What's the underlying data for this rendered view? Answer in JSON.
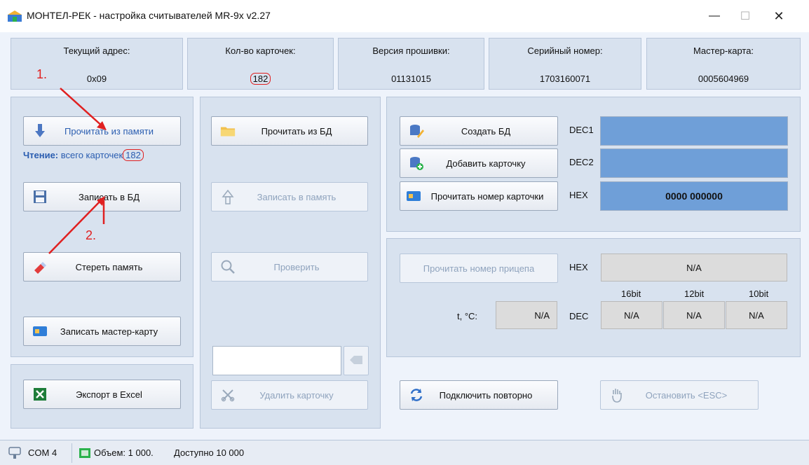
{
  "window": {
    "title": "МОНТЕЛ-РЕК - настройка считывателей MR-9x v2.27",
    "minimize": "—",
    "maximize": "☐",
    "close": "✕"
  },
  "header": [
    {
      "label": "Текущий адрес:",
      "value": "0x09"
    },
    {
      "label": "Кол-во карточек:",
      "value": "182"
    },
    {
      "label": "Версия прошивки:",
      "value": "01131015"
    },
    {
      "label": "Серийный номер:",
      "value": "1703160071"
    },
    {
      "label": "Мастер-карта:",
      "value": "0005604969"
    }
  ],
  "left_panel": {
    "read_memory": "Прочитать из памяти",
    "reading_label": "Чтение:",
    "reading_text": "всего карточек",
    "reading_count": "182",
    "write_db": "Записать в БД",
    "erase_memory": "Стереть память",
    "write_master": "Записать мастер-карту",
    "export_excel": "Экспорт в Excel"
  },
  "middle_panel": {
    "read_db": "Прочитать из БД",
    "write_memory": "Записать в память",
    "check": "Проверить",
    "card_input_value": "",
    "delete_card": "Удалить карточку"
  },
  "right_top": {
    "create_db": "Создать БД",
    "add_card": "Добавить карточку",
    "read_card_number": "Прочитать номер карточки",
    "dec1_label": "DEC1",
    "dec2_label": "DEC2",
    "hex_label": "HEX",
    "dec1_value": "",
    "dec2_value": "",
    "hex_value": "0000 000000"
  },
  "right_bottom": {
    "read_trailer": "Прочитать номер прицепа",
    "hex_label": "HEX",
    "hex_value": "N/A",
    "col_16": "16bit",
    "col_12": "12bit",
    "col_10": "10bit",
    "temp_label": "t, °C:",
    "temp_value": "N/A",
    "dec_label": "DEC",
    "dec_16": "N/A",
    "dec_12": "N/A",
    "dec_10": "N/A"
  },
  "actions": {
    "reconnect": "Подключить повторно",
    "stop": "Остановить <ESC>"
  },
  "annotations": {
    "step1": "1.",
    "step2": "2."
  },
  "status": {
    "port": "COM 4",
    "volume": "Объем: 1 000.",
    "available": "Доступно 10 000"
  },
  "colors": {
    "panel": "#d8e2ef",
    "field_blue": "#6f9fd8",
    "annotation_red": "#e02020"
  }
}
